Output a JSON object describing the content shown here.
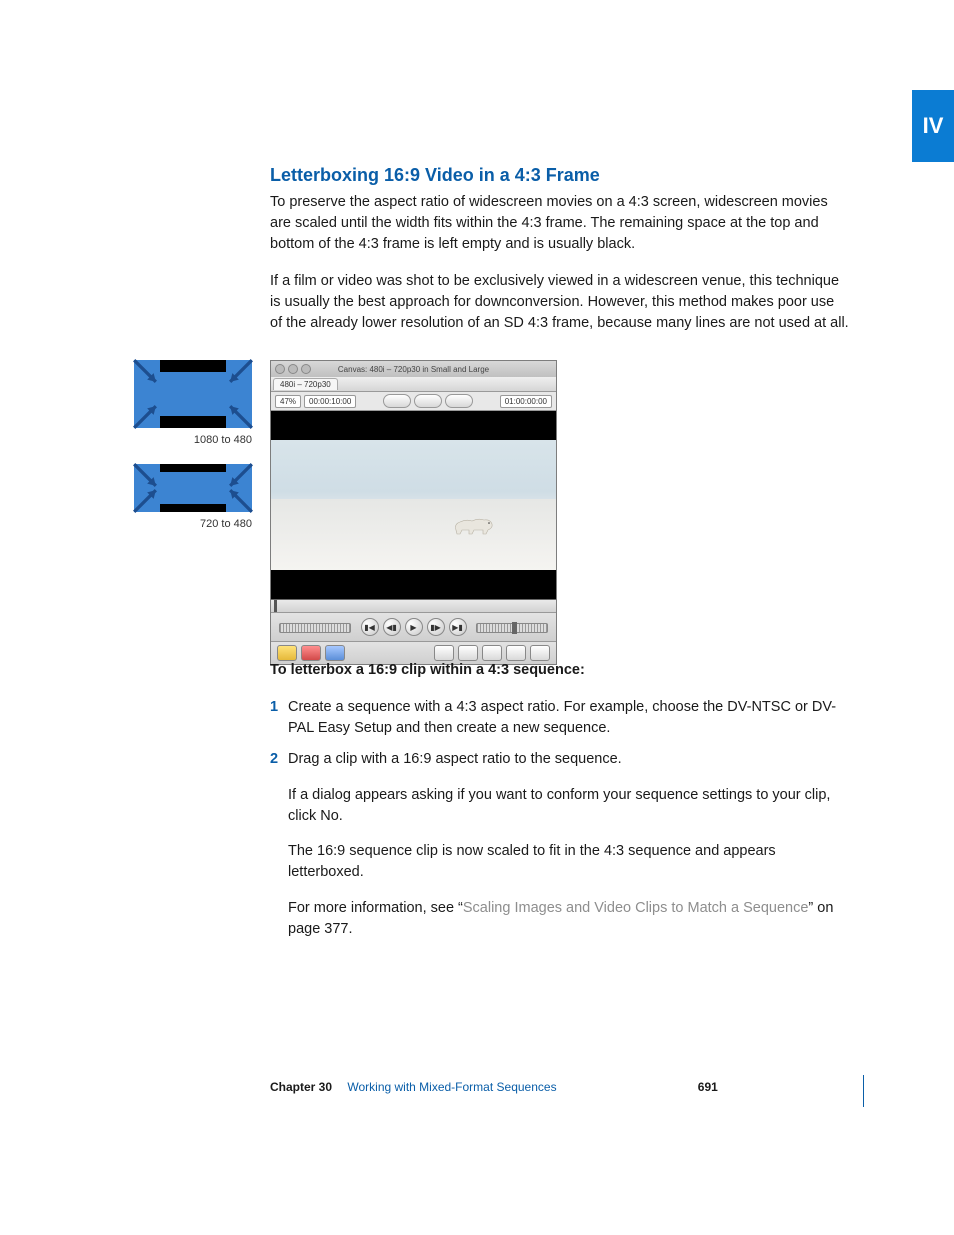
{
  "tab_label": "IV",
  "heading": "Letterboxing 16:9 Video in a 4:3 Frame",
  "para1": "To preserve the aspect ratio of widescreen movies on a 4:3 screen, widescreen movies are scaled until the width fits within the 4:3 frame. The remaining space at the top and bottom of the 4:3 frame is left empty and is usually black.",
  "para2": "If a film or video was shot to be exclusively viewed in a widescreen venue, this technique is usually the best approach for downconversion. However, this method makes poor use of the already lower resolution of an SD 4:3 frame, because many lines are not used at all.",
  "diagram1_caption": "1080 to 480",
  "diagram2_caption": "720 to 480",
  "canvas": {
    "title": "Canvas: 480i – 720p30 in Small and Large",
    "tab": "480i – 720p30",
    "tc_left": "00:00:10:00",
    "tc_right": "01:00:00:00",
    "zoom": "47%"
  },
  "steps_heading": "To letterbox a 16:9 clip within a 4:3 sequence:",
  "step1_num": "1",
  "step1": "Create a sequence with a 4:3 aspect ratio. For example, choose the DV-NTSC or DV-PAL Easy Setup and then create a new sequence.",
  "step2_num": "2",
  "step2": "Drag a clip with a 16:9 aspect ratio to the sequence.",
  "step2a": "If a dialog appears asking if you want to conform your sequence settings to your clip, click No.",
  "step2b": "The 16:9 sequence clip is now scaled to fit in the 4:3 sequence and appears letterboxed.",
  "step2c_pre": "For more information, see “",
  "step2c_link": "Scaling Images and Video Clips to Match a Sequence",
  "step2c_post": "” on page 377.",
  "footer": {
    "chapter": "Chapter 30",
    "title": "Working with Mixed-Format Sequences",
    "page": "691"
  }
}
